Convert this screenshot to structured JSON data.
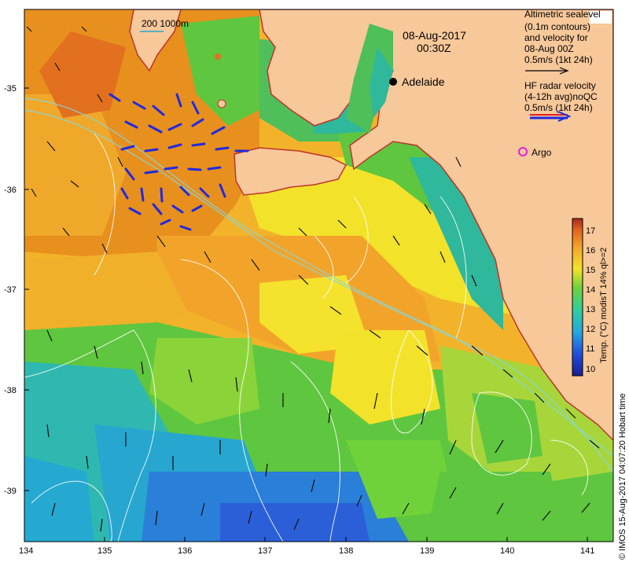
{
  "map": {
    "title_date": "08-Aug-2017",
    "title_time": "00:30Z",
    "scale_label": "200  1000m",
    "city": "Adelaide",
    "argo_label": "Argo",
    "legend_sealevel": [
      "Altimetric sealevel",
      "(0.1m contours)",
      "and velocity for",
      "08-Aug 00Z",
      "0.5m/s (1kt 24h)"
    ],
    "legend_radar": [
      "HF radar velocity",
      "(4-12h avg)noQC",
      "0.5m/s (1kt 24h)"
    ],
    "colorbar_label": "Temp. (°C) modisT 14% ql>=2",
    "colorbar_ticks": [
      "10",
      "11",
      "12",
      "13",
      "14",
      "15",
      "16",
      "17"
    ],
    "credit": "© IMOS 15-Aug-2017 04:07:20 Hobart time",
    "x_ticks": [
      "134",
      "135",
      "136",
      "137",
      "138",
      "139",
      "140",
      "141"
    ],
    "y_ticks": [
      "-35",
      "-36",
      "-37",
      "-38",
      "-39"
    ],
    "colors": {
      "land": "#f7c89a",
      "coast": "#c0342a",
      "warm": "#e8901e",
      "orange": "#f2b32a",
      "yellow": "#f5e22c",
      "green": "#5fc63f",
      "teal": "#2fb89b",
      "cyan": "#27a6cf",
      "blue": "#2a5fd8",
      "radar": "#1f2ae0",
      "argo": "#e020e0"
    }
  }
}
